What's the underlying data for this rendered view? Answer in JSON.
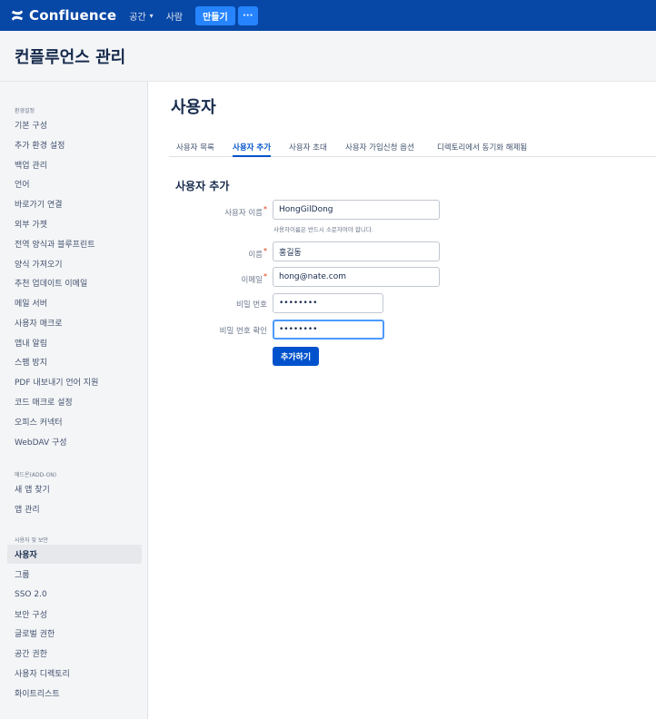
{
  "topnav": {
    "logo_icon": "confluence-logo-icon",
    "brand": "Confluence",
    "spaces_label": "공간",
    "people_label": "사람",
    "create_label": "만들기",
    "more_label": "···",
    "background": "#0747a6",
    "button_color": "#2684ff"
  },
  "admin": {
    "title": "컨플루언스 관리"
  },
  "sidebar": {
    "section_settings": "환경설정",
    "settings_items": [
      "기본 구성",
      "추가 환경 설정",
      "백업 관리",
      "언어",
      "바로가기 연결",
      "외부 가젯",
      "전역 양식과 블루프린트",
      "양식 가져오기",
      "추천 업데이트 이메일",
      "메일 서버",
      "사용자 매크로",
      "앱내 알림",
      "스팸 방지",
      "PDF 내보내기 언어 지원",
      "코드 매크로 설정",
      "오피스 커넥터",
      "WebDAV 구성"
    ],
    "section_addons": "애드온(ADD-ON)",
    "addon_items": [
      "새 앱 찾기",
      "앱 관리"
    ],
    "section_security": "사용자 및 보안",
    "security_items": [
      "사용자",
      "그룹",
      "SSO 2.0",
      "보안 구성",
      "글로벌 권한",
      "공간 권한",
      "사용자 디렉토리",
      "화이트리스트"
    ],
    "active_item": "사용자"
  },
  "main": {
    "title": "사용자",
    "tabs": [
      "사용자 목록",
      "사용자 추가",
      "사용자 초대",
      "사용자 가입신청 옵션",
      "디렉토리에서 동기화 해제됨"
    ],
    "active_tab": "사용자 추가",
    "form": {
      "heading": "사용자 추가",
      "username_label": "사용자 이름",
      "username_value": "HongGilDong",
      "username_help": "사용자이름은 반드시 소문자여야 합니다.",
      "fullname_label": "이름",
      "fullname_value": "홍길동",
      "email_label": "이메일",
      "email_value": "hong@nate.com",
      "password_label": "비밀 번호",
      "password_value": "••••••••",
      "confirm_label": "비밀 번호 확인",
      "confirm_value": "••••••••",
      "required_mark": "*",
      "submit_label": "추가하기"
    }
  }
}
